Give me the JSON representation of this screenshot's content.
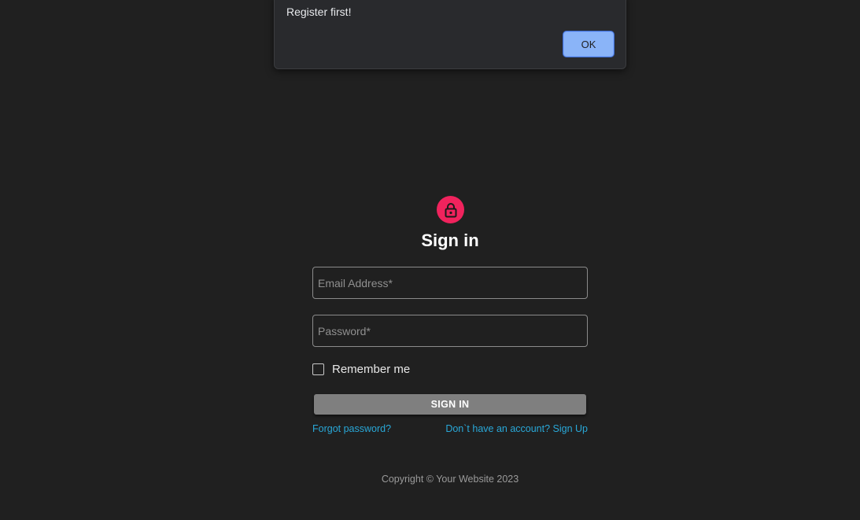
{
  "alert": {
    "message": "Register first!",
    "ok_label": "OK"
  },
  "signin": {
    "title": "Sign in",
    "email_placeholder": "Email Address*",
    "email_value": "",
    "password_placeholder": "Password*",
    "password_value": "",
    "remember_label": "Remember me",
    "remember_checked": false,
    "submit_label": "SIGN IN",
    "forgot_link": "Forgot password?",
    "signup_link": "Don`t have an account? Sign Up"
  },
  "footer": {
    "copyright": "Copyright © Your Website 2023"
  },
  "icons": {
    "lock": "lock-icon"
  },
  "colors": {
    "background": "#202020",
    "accent": "#f0235d",
    "link": "#29a8d8",
    "dialog_button": "#8ab4f8",
    "submit_button": "#7f7f7f"
  }
}
